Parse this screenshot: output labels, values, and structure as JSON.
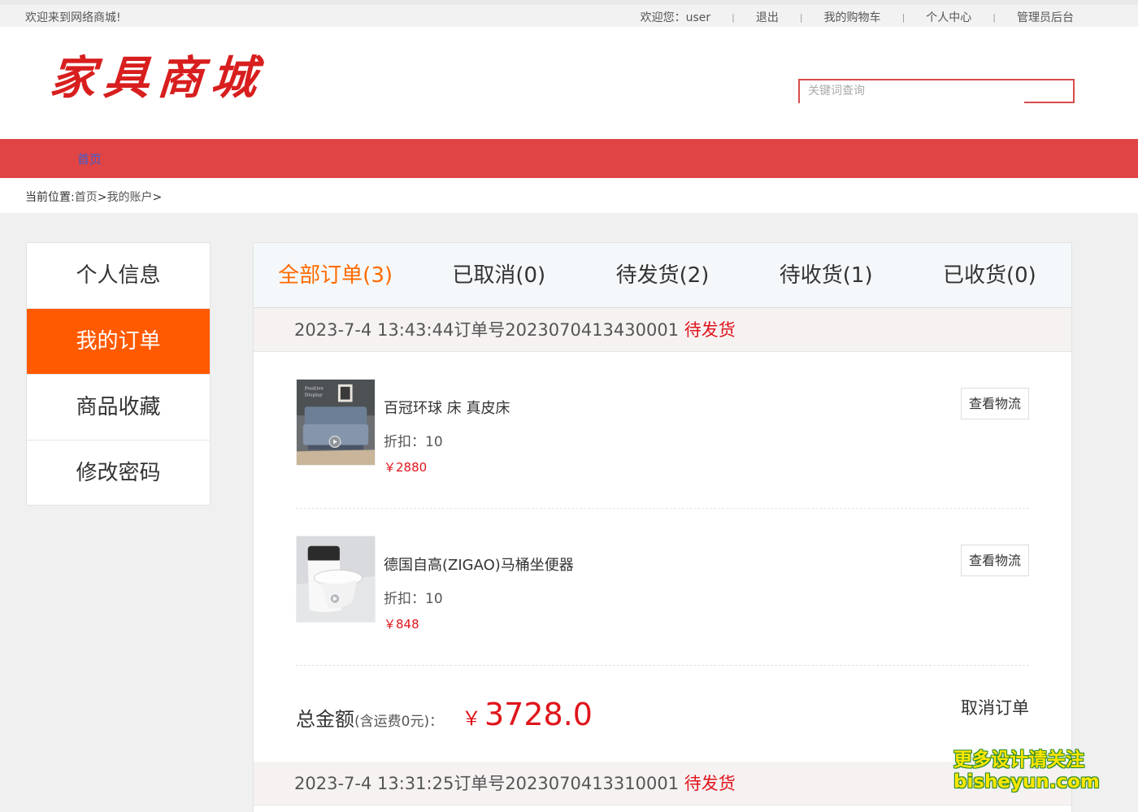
{
  "topbar": {
    "welcome": "欢迎来到网络商城!",
    "greeting": "欢迎您：user",
    "logout": "退出",
    "cart": "我的购物车",
    "center": "个人中心",
    "admin": "管理员后台"
  },
  "header": {
    "logo": "家具商城",
    "search_placeholder": "关键词查询"
  },
  "nav": {
    "home": "首页"
  },
  "breadcrumb": {
    "prefix": "当前位置:",
    "home": "首页",
    "sep": ">",
    "account": "我的账户",
    "tail": ">"
  },
  "sidebar": {
    "items": [
      {
        "label": "个人信息"
      },
      {
        "label": "我的订单"
      },
      {
        "label": "商品收藏"
      },
      {
        "label": "修改密码"
      }
    ]
  },
  "tabs": [
    {
      "label": "全部订单(3)"
    },
    {
      "label": "已取消(0)"
    },
    {
      "label": "待发货(2)"
    },
    {
      "label": "待收货(1)"
    },
    {
      "label": "已收货(0)"
    }
  ],
  "orders": [
    {
      "time": "2023-7-4 13:43:44",
      "no_label": "订单号",
      "no": "2023070413430001",
      "status": "待发货",
      "items": [
        {
          "name": "百冠环球 床 真皮床",
          "discount": "折扣：10",
          "price": "￥2880",
          "button": "查看物流",
          "image": "bed-image"
        },
        {
          "name": "德国自高(ZIGAO)马桶坐便器",
          "discount": "折扣：10",
          "price": "￥848",
          "button": "查看物流",
          "image": "toilet-image"
        }
      ],
      "total_label": "总金额",
      "total_note": "(含运费0元)：",
      "currency": "￥",
      "total": "3728.0",
      "cancel": "取消订单"
    },
    {
      "time": "2023-7-4 13:31:25",
      "no_label": "订单号",
      "no": "2023070413310001",
      "status": "待发货"
    }
  ],
  "watermark": {
    "line1": "更多设计请关注",
    "line2": "bisheyun.com"
  },
  "colors": {
    "nav_red": "#e04444",
    "active_orange": "#ff5a00",
    "price_red": "#e0141b",
    "tab_active": "#ff6a00"
  }
}
